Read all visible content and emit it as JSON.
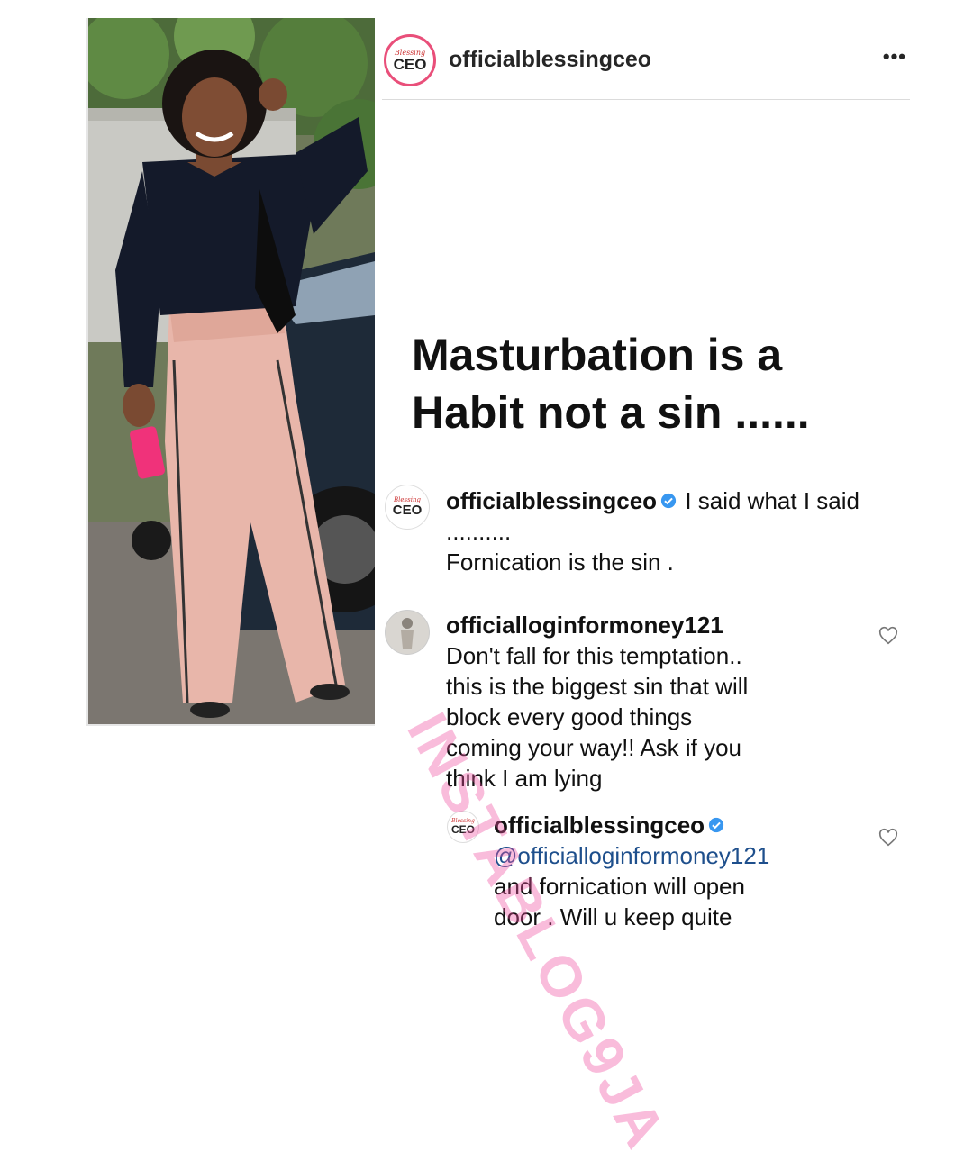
{
  "header": {
    "username": "officialblessingceo",
    "avatar": {
      "small_text": "Blessing",
      "big_text": "CEO"
    },
    "more_icon": "•••"
  },
  "post": {
    "line1": "Masturbation is a",
    "line2": "Habit not a sin ......"
  },
  "comments": [
    {
      "username": "officialblessingceo",
      "verified": true,
      "text": "I said what I said ..........",
      "text2": "Fornication is the sin .",
      "avatar": {
        "small_text": "Blessing",
        "big_text": "CEO"
      }
    },
    {
      "username": "officialloginformoney121",
      "lines": [
        "Don't fall for this temptation..",
        "this is the biggest sin that will",
        "block every good things",
        "coming your way!! Ask if you",
        "think I am lying"
      ],
      "like_icon": "heart-outline"
    },
    {
      "username": "officialblessingceo",
      "verified": true,
      "mention": "@officialloginformoney121",
      "lines": [
        "and fornication will open",
        "door . Will u keep quite"
      ],
      "avatar": {
        "small_text": "Blessing",
        "big_text": "CEO"
      },
      "like_icon": "heart-outline"
    }
  ],
  "watermark": "INSTABLOG9JA",
  "colors": {
    "verified": "#3897f0",
    "story_ring": "#e94f7a",
    "mention": "#1e4f8c",
    "watermark": "#f050a0"
  }
}
